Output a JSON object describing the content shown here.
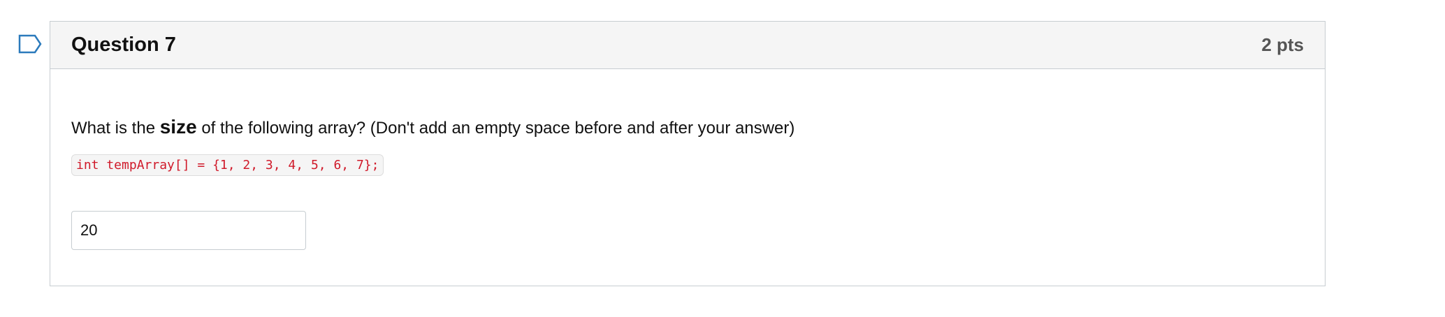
{
  "question": {
    "flag_icon": "bookmark-flag-icon",
    "title": "Question 7",
    "points": "2 pts",
    "prompt_before": "What is the ",
    "prompt_emphasis": "size",
    "prompt_after": " of the following array? (Don't add an empty space before and after your answer)",
    "code": "int tempArray[] = {1, 2, 3, 4, 5, 6, 7};",
    "answer_value": "20"
  },
  "colors": {
    "header_bg": "#f5f5f5",
    "border": "#c7cdd1",
    "code_text": "#d01a2a",
    "flag_stroke": "#2b7abc"
  }
}
